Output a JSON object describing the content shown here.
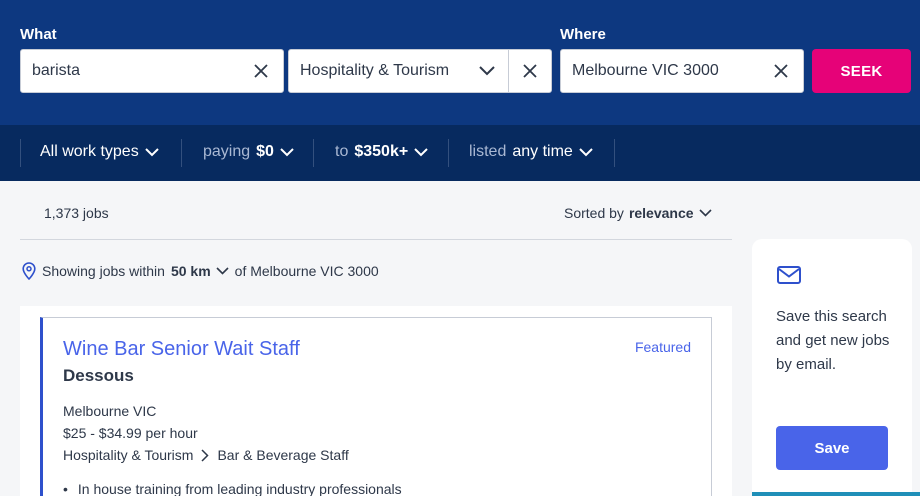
{
  "search": {
    "what_label": "What",
    "where_label": "Where",
    "keyword": "barista",
    "classification": "Hospitality & Tourism",
    "location": "Melbourne VIC 3000",
    "seek_label": "SEEK"
  },
  "filters": {
    "work_types": "All work types",
    "paying_prefix": "paying",
    "paying_value": "$0",
    "to_prefix": "to",
    "to_value": "$350k+",
    "listed_prefix": "listed",
    "listed_value": "any time"
  },
  "results": {
    "count": "1,373 jobs",
    "sorted_prefix": "Sorted by",
    "sorted_value": "relevance",
    "within_prefix": "Showing jobs within",
    "within_distance": "50 km",
    "within_suffix": "of Melbourne VIC 3000"
  },
  "job": {
    "title": "Wine Bar Senior Wait Staff",
    "company": "Dessous",
    "featured": "Featured",
    "location": "Melbourne VIC",
    "salary": "$25 - $34.99 per hour",
    "classification": "Hospitality & Tourism",
    "subclassification": "Bar & Beverage Staff",
    "bullet": "In house training from leading industry professionals"
  },
  "save_panel": {
    "text": "Save this search and get new jobs by email.",
    "button": "Save"
  },
  "colors": {
    "brand_navy": "#0d3880",
    "filter_navy": "#072a5f",
    "seek_pink": "#e60278",
    "link_blue": "#4964e9"
  }
}
